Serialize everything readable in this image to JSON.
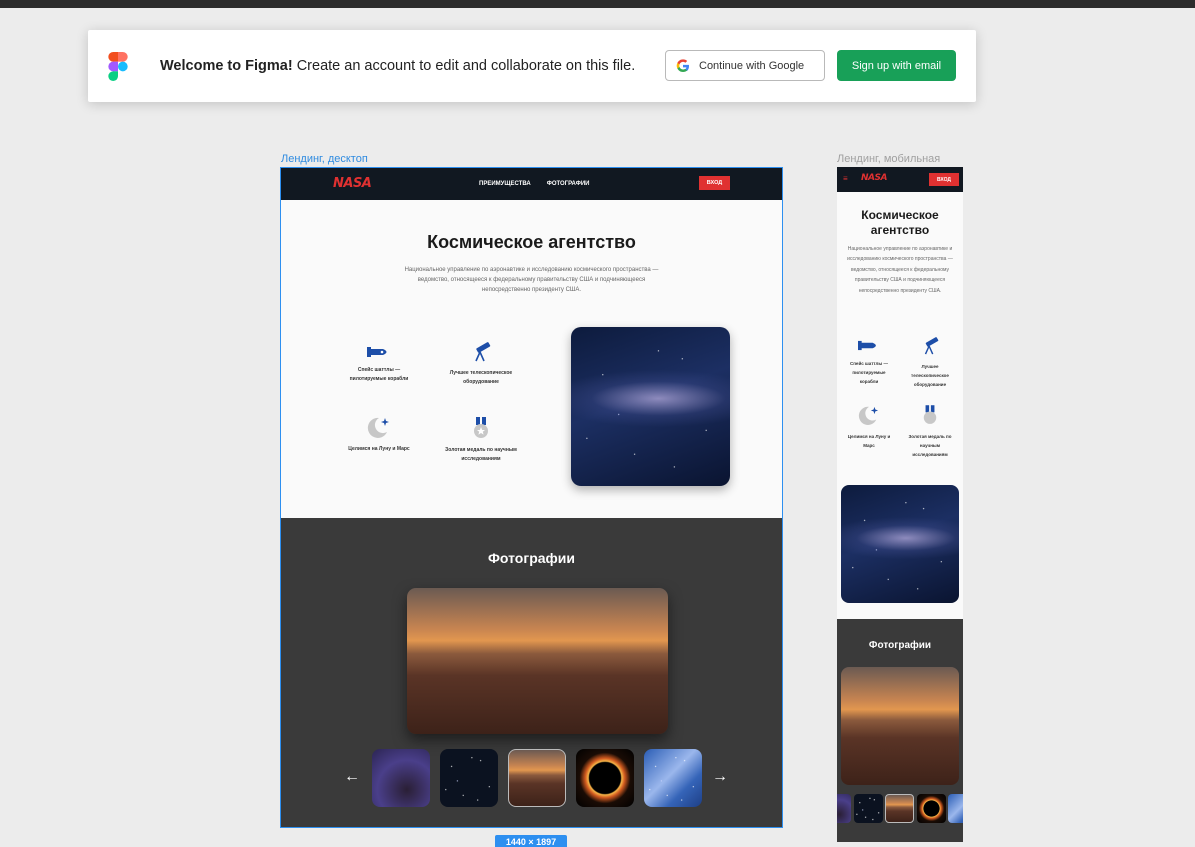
{
  "banner": {
    "welcome": "Welcome to Figma!",
    "message": "Create an account to edit and collaborate on this file.",
    "google_button": "Continue with Google",
    "email_button": "Sign up with email"
  },
  "frames": {
    "desktop_label": "Лендинг, десктоп",
    "mobile_label": "Лендинг, мобильная",
    "size_badge": "1440 × 1897"
  },
  "site": {
    "logo": "NASA",
    "nav": [
      "ПРЕИМУЩЕСТВА",
      "ФОТОГРАФИИ"
    ],
    "login": "ВХОД",
    "hero_title": "Космическое агентство",
    "hero_text": "Национальное управление по аэронавтике и исследованию космического пространства — ведомство, относящееся к федеральному правительству США и подчиняющееся непосредственно президенту США.",
    "features": [
      {
        "icon": "shuttle-icon",
        "label": "Спейс шаттлы — пилотируемые корабли"
      },
      {
        "icon": "telescope-icon",
        "label": "Лучшее телескопическое оборудование"
      },
      {
        "icon": "moon-icon",
        "label": "Целимся на Луну и Марс"
      },
      {
        "icon": "medal-icon",
        "label": "Золотая медаль по научным исследованиям"
      }
    ],
    "photos_title": "Фотографии"
  },
  "colors": {
    "accent": "#e03131",
    "nav_bg": "#111821",
    "figma_green": "#18a058",
    "selection": "#2d8ff0",
    "icon_blue": "#1d4ea8"
  }
}
